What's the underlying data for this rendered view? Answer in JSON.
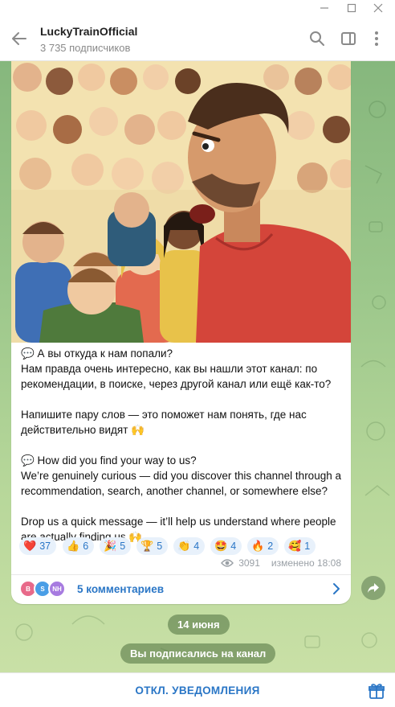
{
  "window": {
    "minimize_icon": "minimize-icon",
    "maximize_icon": "maximize-icon",
    "close_icon": "close-icon"
  },
  "header": {
    "title": "LuckyTrainOfficial",
    "subtitle": "3 735 подписчиков"
  },
  "post": {
    "lines_ru": [
      "💬 А вы откуда к нам попали?",
      "Нам правда очень интересно, как вы нашли этот канал: по",
      "рекомендации, в поиске, через другой канал или ещё как-то?",
      "",
      "Напишите пару слов — это поможет нам понять, где нас",
      "действительно видят 🙌"
    ],
    "lines_en": [
      "💬 How did you find your way to us?",
      "We’re genuinely curious — did you discover this channel through a",
      "recommendation, search, another channel, or somewhere else?",
      "",
      "Drop us a quick message — it’ll help us understand where people",
      "are actually finding us 🙌"
    ],
    "reactions": [
      {
        "emoji": "❤️",
        "count": "37"
      },
      {
        "emoji": "👍",
        "count": "6"
      },
      {
        "emoji": "🎉",
        "count": "5"
      },
      {
        "emoji": "🏆",
        "count": "5"
      },
      {
        "emoji": "👏",
        "count": "4"
      },
      {
        "emoji": "🤩",
        "count": "4"
      },
      {
        "emoji": "🔥",
        "count": "2"
      },
      {
        "emoji": "🥰",
        "count": "1"
      }
    ],
    "views": "3091",
    "edited": "изменено 18:08",
    "comment_avatars": [
      {
        "initials": "B",
        "color": "#e86a8a"
      },
      {
        "initials": "S",
        "color": "#4a9ee6"
      },
      {
        "initials": "NH",
        "color": "#a77be0"
      }
    ],
    "comments_label": "5 комментариев"
  },
  "date_pill": "14 июня",
  "service_pill": "Вы подписались на канал",
  "bottom": {
    "mute_label": "ОТКЛ. УВЕДОМЛЕНИЯ"
  },
  "colors": {
    "accent": "#2a76c6",
    "chat_bg": "#9ac68a",
    "reaction_bg": "#e8f1fb"
  }
}
